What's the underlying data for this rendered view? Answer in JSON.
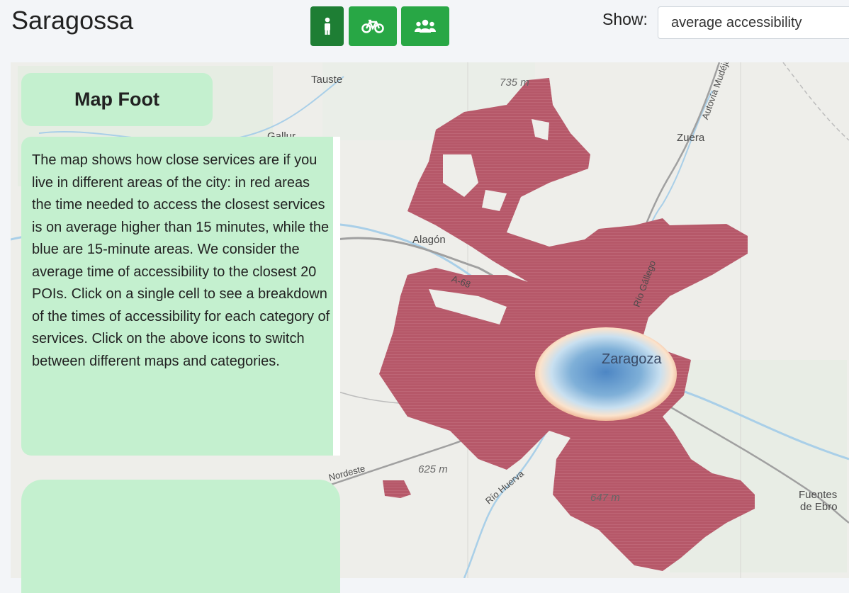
{
  "header": {
    "city": "Saragossa",
    "show_label": "Show:",
    "show_value": "average accessibility"
  },
  "modes": [
    {
      "name": "walk",
      "icon": "walking-person-icon",
      "active": true
    },
    {
      "name": "bike",
      "icon": "bicycle-icon",
      "active": false
    },
    {
      "name": "people",
      "icon": "users-icon",
      "active": false
    }
  ],
  "panel": {
    "title": "Map Foot",
    "description": "The map shows how close services are if you live in different areas of the city: in red areas the time needed to access the closest services is on average higher than 15 minutes, while the blue are 15-minute areas. We consider the average time of accessibility to the closest 20 POIs. Click on a single cell to see a breakdown of the times of accessibility for each category of services. Click on the above icons to switch between different maps and categories."
  },
  "map": {
    "labels": {
      "tauste": "Tauste",
      "gallur": "Gallur",
      "zuera": "Zuera",
      "alagon": "Alagón",
      "zaragoza": "Zaragoza",
      "fuentes": "Fuentes",
      "de_ebro": "de Ebro",
      "autovia": "Autovía Mudéjar",
      "gallego": "Río Gállego",
      "a68": "A-68",
      "nordeste": "Nordeste",
      "huerva": "Río Huerva",
      "elev_735": "735 m",
      "elev_625": "625 m",
      "elev_647": "647 m"
    },
    "colors": {
      "far": "#b85a6a",
      "near": "#7fb0d8",
      "mid": "#f4d8c0"
    }
  }
}
